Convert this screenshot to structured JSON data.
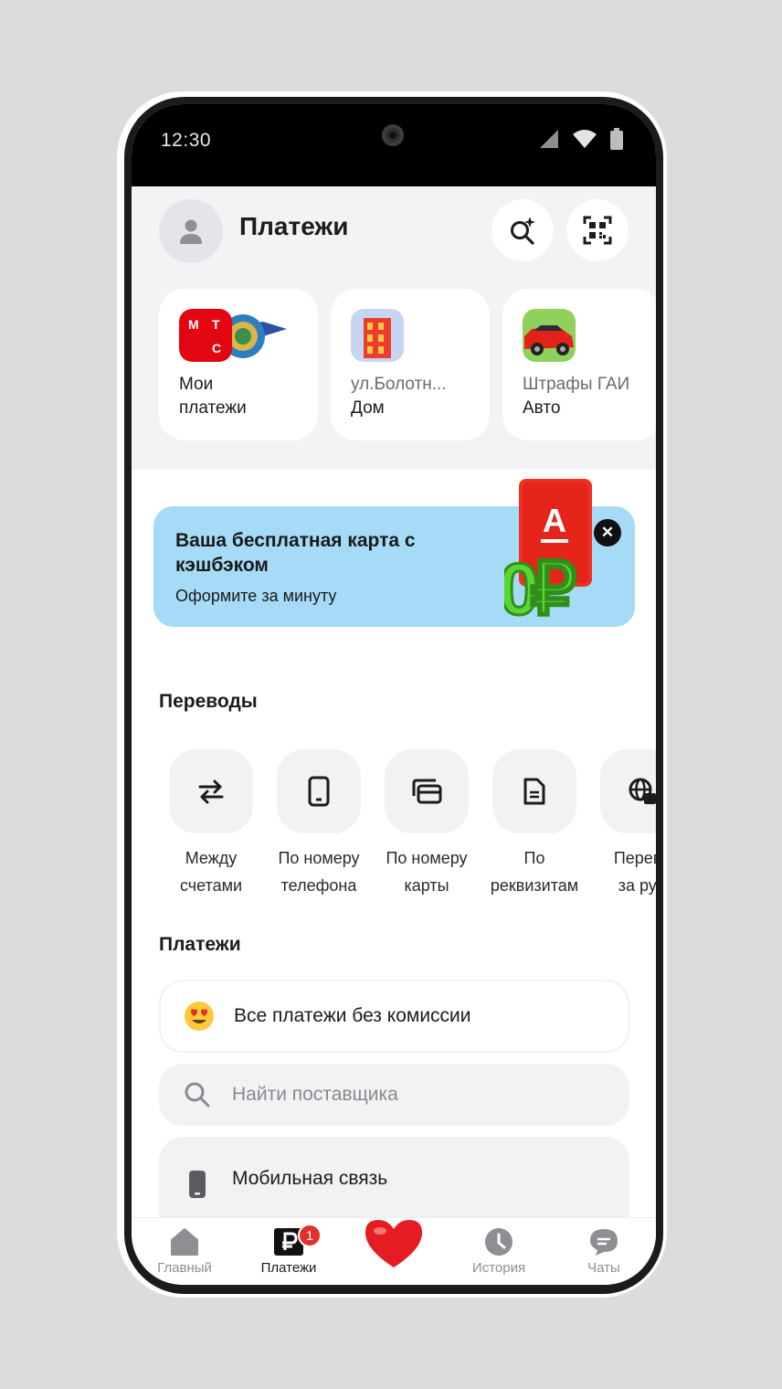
{
  "status_bar": {
    "time": "12:30"
  },
  "header": {
    "title": "Платежи"
  },
  "quick_cards": [
    {
      "line1": "Мои",
      "line2": "платежи",
      "icon": "mts-logo-icon"
    },
    {
      "line1": "ул.Болотн...",
      "line2": "Дом",
      "icon": "building-icon"
    },
    {
      "line1": "Штрафы ГАИ",
      "line2": "Авто",
      "icon": "car-icon"
    }
  ],
  "promo": {
    "title": "Ваша бесплатная карта с кэшбэком",
    "subtitle": "Оформите за минуту",
    "card_letter": "А",
    "badge_text": "0₽",
    "accent": "#a5dbf7"
  },
  "transfers": {
    "title": "Переводы",
    "items": [
      {
        "label": "Между\nсчетами",
        "icon": "swap-arrows-icon"
      },
      {
        "label": "По номеру\nтелефона",
        "icon": "phone-icon"
      },
      {
        "label": "По номеру\nкарты",
        "icon": "cards-icon"
      },
      {
        "label": "По\nреквизитам",
        "icon": "document-icon"
      },
      {
        "label": "Перево\nза руб",
        "icon": "globe-icon"
      }
    ]
  },
  "payments": {
    "title": "Платежи",
    "commission_label": "Все платежи без комиссии",
    "search_placeholder": "Найти поставщика",
    "mobile_label": "Мобильная связь"
  },
  "bottom_nav": {
    "items": [
      {
        "label": "Главный",
        "icon": "home-icon"
      },
      {
        "label": "Платежи",
        "icon": "payments-ruble-icon",
        "badge": "1"
      },
      {
        "label": "",
        "icon": "heart-icon"
      },
      {
        "label": "История",
        "icon": "history-clock-icon"
      },
      {
        "label": "Чаты",
        "icon": "chat-icon"
      }
    ]
  },
  "colors": {
    "badge": "#e5302a",
    "brand_red": "#ef3124",
    "promo_bg": "#a5dbf7"
  }
}
